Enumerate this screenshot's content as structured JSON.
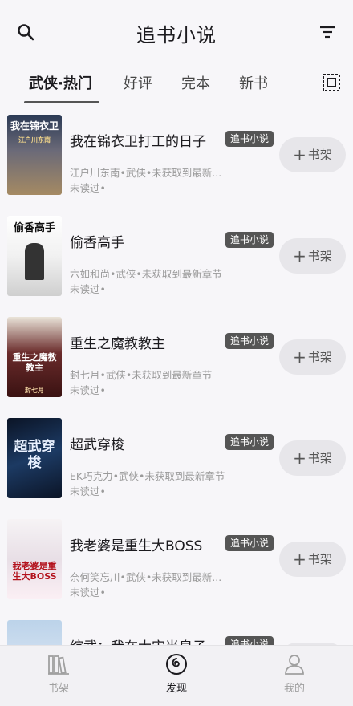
{
  "header": {
    "title": "追书小说",
    "search_icon": "search-icon",
    "filter_icon": "filter-icon"
  },
  "tabs": [
    {
      "label": "武侠·热门",
      "active": true
    },
    {
      "label": "好评",
      "active": false
    },
    {
      "label": "完本",
      "active": false
    },
    {
      "label": "新书",
      "active": false
    }
  ],
  "books": [
    {
      "title": "我在锦衣卫打工的日子",
      "source": "追书小说",
      "meta": "江户川东南•武侠•未获取到最新...",
      "read_status": "未读过•",
      "add_label": "书架",
      "cover_text": "我在锦衣卫",
      "cover_sub": "江户川东南"
    },
    {
      "title": "偷香高手",
      "source": "追书小说",
      "meta": "六如和尚•武侠•未获取到最新章节",
      "read_status": "未读过•",
      "add_label": "书架",
      "cover_text": "偷香高手",
      "cover_sub": ""
    },
    {
      "title": "重生之魔教教主",
      "source": "追书小说",
      "meta": "封七月•武侠•未获取到最新章节",
      "read_status": "未读过•",
      "add_label": "书架",
      "cover_text": "重生之魔教教主",
      "cover_sub": "封七月"
    },
    {
      "title": "超武穿梭",
      "source": "追书小说",
      "meta": "EK巧克力•武侠•未获取到最新章节",
      "read_status": "未读过•",
      "add_label": "书架",
      "cover_text": "超武穿梭",
      "cover_sub": ""
    },
    {
      "title": "我老婆是重生大BOSS",
      "source": "追书小说",
      "meta": "奈何笑忘川•武侠•未获取到最新...",
      "read_status": "未读过•",
      "add_label": "书架",
      "cover_text": "我老婆是重生大BOSS",
      "cover_sub": ""
    },
    {
      "title": "综武：我在大宋当皇子",
      "source": "追书小说",
      "meta": "",
      "read_status": "",
      "add_label": "书架",
      "cover_text": "",
      "cover_sub": ""
    }
  ],
  "bottom_nav": [
    {
      "label": "书架",
      "icon": "bookshelf-icon",
      "active": false
    },
    {
      "label": "发现",
      "icon": "discover-icon",
      "active": true
    },
    {
      "label": "我的",
      "icon": "profile-icon",
      "active": false
    }
  ],
  "colors": {
    "background": "#f7f6f9",
    "badge": "#555555",
    "button_bg": "#e7e6ea",
    "muted_text": "#9a9a9a"
  }
}
